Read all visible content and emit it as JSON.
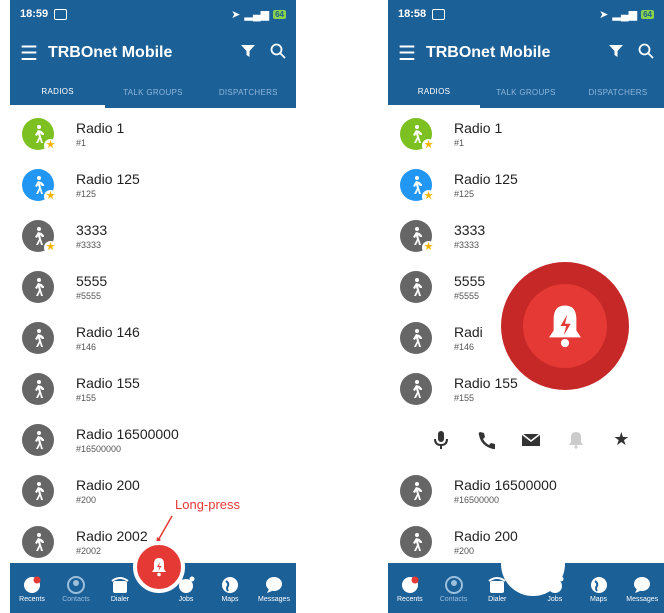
{
  "app": {
    "title": "TRBOnet Mobile"
  },
  "left_screen": {
    "time": "18:59",
    "battery": "64"
  },
  "right_screen": {
    "time": "18:58",
    "battery": "64"
  },
  "tabs": [
    "RADIOS",
    "TALK GROUPS",
    "DISPATCHERS"
  ],
  "radios_left": [
    {
      "name": "Radio 1",
      "id": "#1",
      "color": "#7cc022",
      "starred": true
    },
    {
      "name": "Radio 125",
      "id": "#125",
      "color": "#2196f3",
      "starred": true
    },
    {
      "name": "3333",
      "id": "#3333",
      "color": "#666666",
      "starred": true
    },
    {
      "name": "5555",
      "id": "#5555",
      "color": "#666666",
      "starred": false
    },
    {
      "name": "Radio 146",
      "id": "#146",
      "color": "#666666",
      "starred": false
    },
    {
      "name": "Radio 155",
      "id": "#155",
      "color": "#666666",
      "starred": false
    },
    {
      "name": "Radio 16500000",
      "id": "#16500000",
      "color": "#666666",
      "starred": false
    },
    {
      "name": "Radio 200",
      "id": "#200",
      "color": "#666666",
      "starred": false
    },
    {
      "name": "Radio 2002",
      "id": "#2002",
      "color": "#666666",
      "starred": false
    }
  ],
  "radios_right_top": [
    {
      "name": "Radio 1",
      "id": "#1"
    },
    {
      "name": "Radio 125",
      "id": "#125"
    },
    {
      "name": "3333",
      "id": "#3333"
    },
    {
      "name": "5555",
      "id": "#5555"
    },
    {
      "name": "Radi",
      "id": "#146"
    },
    {
      "name": "Radio 155",
      "id": "#155"
    }
  ],
  "radios_right_bottom": [
    {
      "name": "Radio 16500000",
      "id": "#16500000"
    },
    {
      "name": "Radio 200",
      "id": "#200"
    }
  ],
  "bottom_nav": {
    "recents": "Recents",
    "contacts": "Contacts",
    "dialer": "Dialer",
    "jobs": "Jobs",
    "maps": "Maps",
    "messages": "Messages"
  },
  "annotation": "Long-press",
  "right_nav_fragment": "2",
  "colors": {
    "primary": "#1c6098",
    "alarm": "#e53935",
    "star": "#f4b400"
  }
}
